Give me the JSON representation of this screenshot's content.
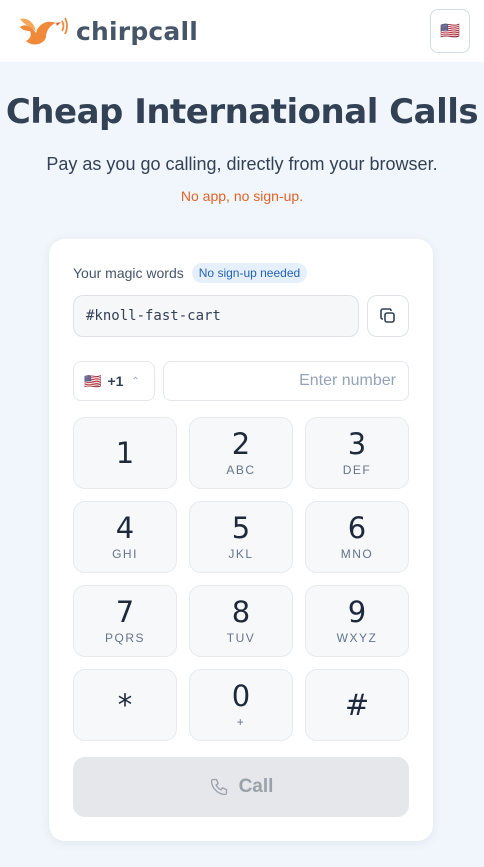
{
  "header": {
    "logo_text": "chirpcall",
    "flag_emoji": "🇺🇸",
    "logo_icon": "bird-icon",
    "brand_color": "#f08a3a"
  },
  "hero": {
    "title": "Cheap International Calls",
    "subtitle": "Pay as you go calling, directly from your browser.",
    "note": "No app, no sign-up."
  },
  "magic": {
    "label": "Your magic words",
    "badge": "No sign-up needed",
    "value": "#knoll-fast-cart",
    "copy_icon": "copy-icon"
  },
  "dialer": {
    "country_flag": "🇺🇸",
    "country_code": "+1",
    "number_placeholder": "Enter number",
    "keys": [
      {
        "digit": "1",
        "letters": ""
      },
      {
        "digit": "2",
        "letters": "ABC"
      },
      {
        "digit": "3",
        "letters": "DEF"
      },
      {
        "digit": "4",
        "letters": "GHI"
      },
      {
        "digit": "5",
        "letters": "JKL"
      },
      {
        "digit": "6",
        "letters": "MNO"
      },
      {
        "digit": "7",
        "letters": "PQRS"
      },
      {
        "digit": "8",
        "letters": "TUV"
      },
      {
        "digit": "9",
        "letters": "WXYZ"
      },
      {
        "digit": "*",
        "letters": ""
      },
      {
        "digit": "0",
        "letters": "+"
      },
      {
        "digit": "#",
        "letters": ""
      }
    ],
    "call_label": "Call",
    "call_icon": "phone-icon"
  },
  "colors": {
    "accent_note": "#e0622a",
    "badge_bg": "#e6f0fc",
    "badge_text": "#2563b0",
    "call_disabled_bg": "#e5e7ea"
  }
}
